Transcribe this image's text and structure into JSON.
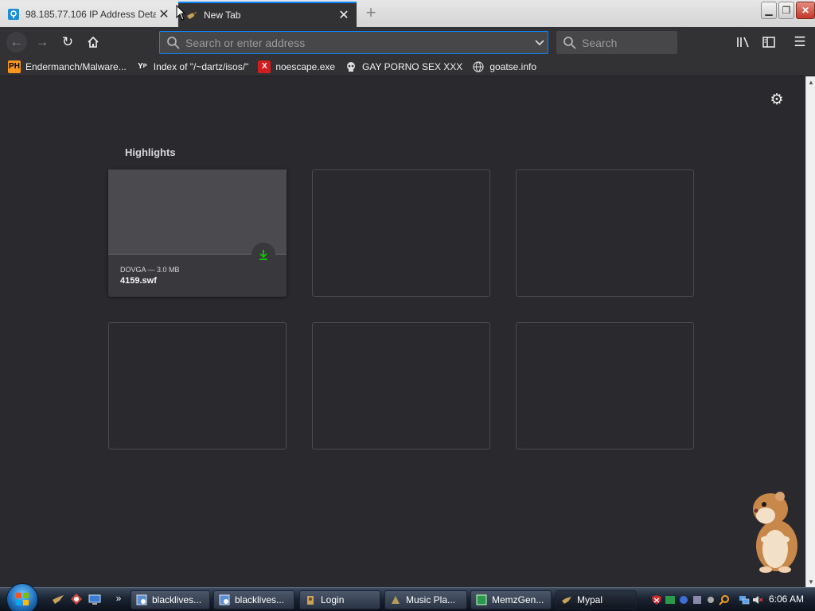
{
  "browser": {
    "tabs": [
      {
        "label": "98.185.77.106 IP Address Detai",
        "active": false,
        "icon": "location-pin-icon"
      },
      {
        "label": "New Tab",
        "active": true,
        "icon": "mypal-icon"
      }
    ],
    "url_placeholder": "Search or enter address",
    "search_placeholder": "Search"
  },
  "bookmarks": [
    {
      "label": "Endermanch/Malware...",
      "icon_text": "PH",
      "icon_bg": "#f7971e",
      "icon_fg": "#000000"
    },
    {
      "label": "Index of \"/~dartz/isos/\"",
      "icon_text": "Y",
      "icon_bg": "#2a2a2e",
      "icon_fg": "#ffffff"
    },
    {
      "label": "noescape.exe",
      "icon_text": "X",
      "icon_bg": "#d01d1d",
      "icon_fg": "#ffffff"
    },
    {
      "label": "GAY PORNO SEX XXX",
      "icon_text": "",
      "icon_bg": "",
      "icon_fg": ""
    },
    {
      "label": "goatse.info",
      "icon_text": "",
      "icon_bg": "",
      "icon_fg": ""
    }
  ],
  "newtab": {
    "section_title": "Highlights",
    "highlight": {
      "meta": "DOVGA — 3.0 MB",
      "filename": "4159.swf"
    }
  },
  "taskbar": {
    "buttons": [
      {
        "label": "blacklives..."
      },
      {
        "label": "blacklives..."
      },
      {
        "label": "Login"
      },
      {
        "label": "Music Pla..."
      },
      {
        "label": "MemzGen..."
      },
      {
        "label": "Mypal"
      }
    ],
    "clock": "6:06 AM"
  },
  "colors": {
    "accent": "#0a84ff",
    "download_green": "#12bc00",
    "content_bg": "#2a2a2e",
    "toolbar_bg": "#323234"
  }
}
